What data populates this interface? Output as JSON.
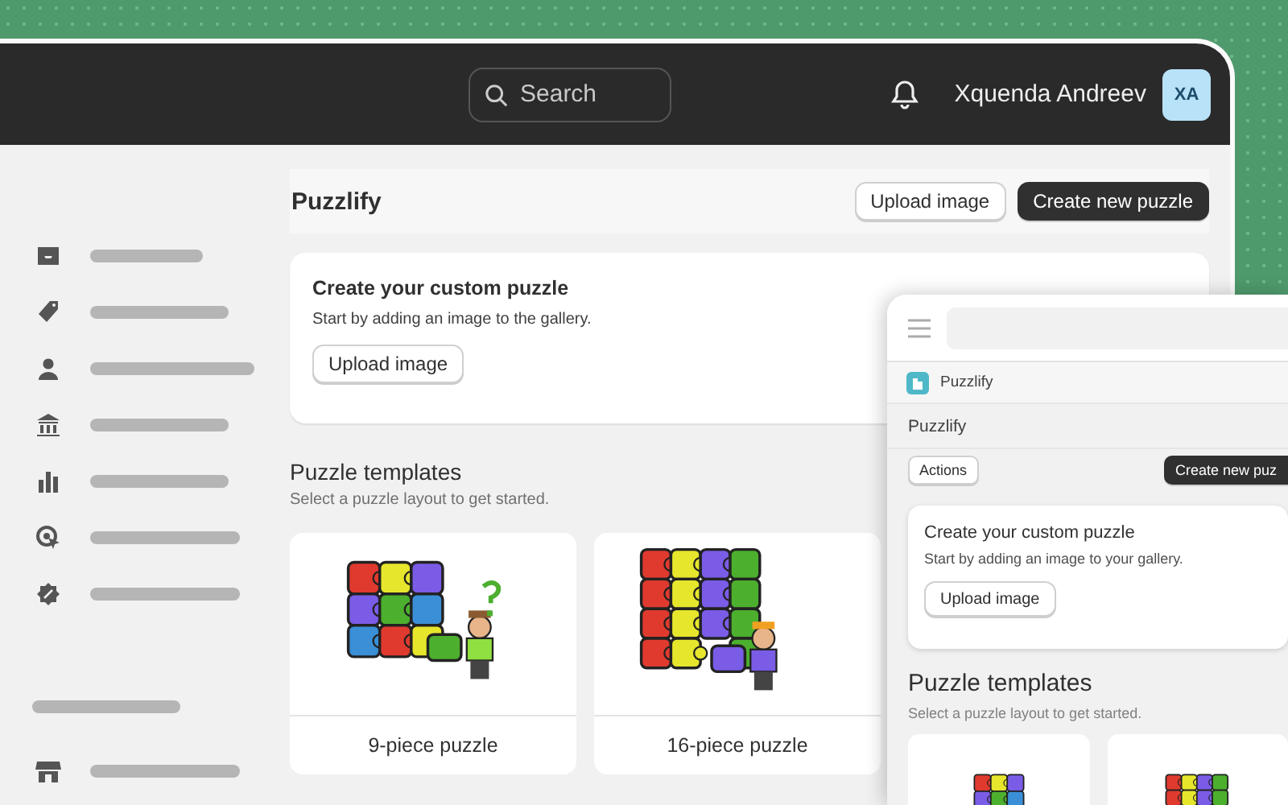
{
  "header": {
    "search": {
      "placeholder": "Search"
    },
    "user": {
      "name": "Xquenda Andreev",
      "initials": "XA"
    }
  },
  "page": {
    "title": "Puzzlify",
    "buttons": [
      {
        "label": "Upload image",
        "kind": "secondary"
      },
      {
        "label": "Create new puzzle",
        "kind": "primary"
      }
    ],
    "custom_card": {
      "title": "Create your custom puzzle",
      "text": "Start by adding an image to the gallery.",
      "button": "Upload image"
    },
    "templates": {
      "title": "Puzzle templates",
      "subtitle": "Select a puzzle layout to get started.",
      "items": [
        {
          "label": "9-piece puzzle",
          "kind": "small"
        },
        {
          "label": "16-piece puzzle",
          "kind": "large"
        }
      ]
    }
  },
  "mobile": {
    "app_name": "Puzzlify",
    "title": "Puzzlify",
    "buttons": [
      {
        "label": "Actions",
        "kind": "secondary"
      },
      {
        "label": "Create new puz",
        "kind": "primary"
      }
    ],
    "custom_card": {
      "title": "Create your custom puzzle",
      "text": "Start by adding an image to your gallery.",
      "button": "Upload image"
    },
    "templates": {
      "title": "Puzzle templates",
      "subtitle": "Select a puzzle layout to get started.",
      "items": [
        {
          "kind": "small"
        },
        {
          "kind": "large"
        }
      ]
    }
  }
}
